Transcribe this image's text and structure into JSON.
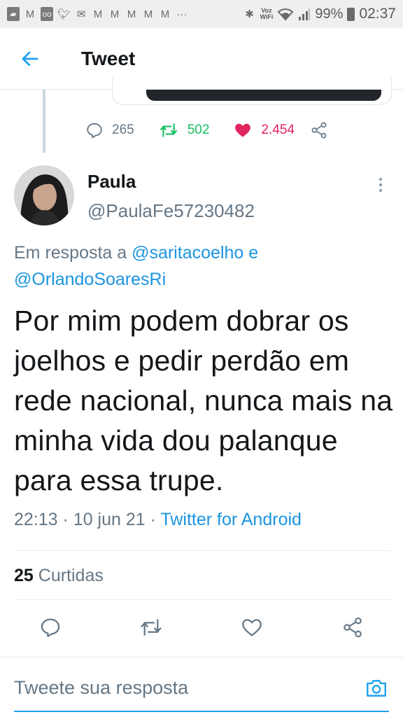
{
  "status_bar": {
    "time": "02:37",
    "battery": "99%",
    "voz_label_top": "Voz",
    "voz_label_bottom": "WiFi",
    "more_dots": "···"
  },
  "header": {
    "title": "Tweet"
  },
  "previous_tweet": {
    "replies": "265",
    "retweets": "502",
    "likes": "2.454"
  },
  "tweet": {
    "author_name": "Paula",
    "author_handle": "@PaulaFe57230482",
    "reply_prefix": "Em resposta a",
    "reply_user_1": "@saritacoelho",
    "reply_joiner": "e",
    "reply_user_2": "@OrlandoSoaresRi",
    "text": "Por mim podem dobrar os joelhos e pedir perdão em rede nacional, nunca mais na minha vida dou palanque para essa trupe.",
    "time": "22:13",
    "date": "10 jun 21",
    "separator": "·",
    "source": "Twitter for Android",
    "like_count": "25",
    "like_label": "Curtidas"
  },
  "reply_box": {
    "placeholder": "Tweete sua resposta"
  },
  "colors": {
    "accent": "#1da1f2",
    "link": "#1b95e0",
    "retweet": "#17bf63",
    "like": "#e0245e",
    "muted": "#657786"
  },
  "icons": {
    "back": "arrow-left-icon",
    "reply": "reply-icon",
    "retweet": "retweet-icon",
    "like": "heart-icon",
    "share": "share-icon",
    "camera": "camera-icon",
    "more": "more-vertical-icon"
  }
}
